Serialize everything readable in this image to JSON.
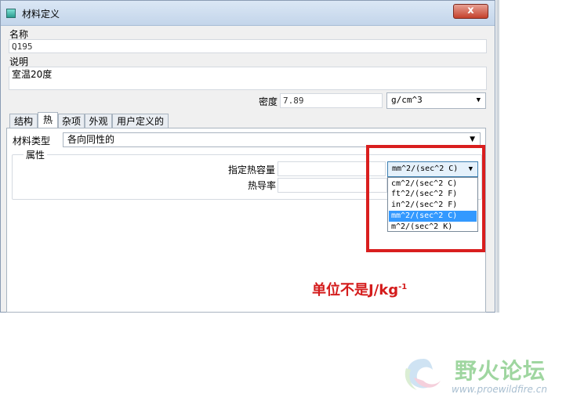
{
  "window": {
    "title": "材料定义",
    "close_label": "x"
  },
  "name": {
    "label": "名称",
    "value": "Q195"
  },
  "description": {
    "label": "说明",
    "value": "室温20度"
  },
  "density": {
    "label": "密度",
    "value": "7.89",
    "unit": "g/cm^3"
  },
  "tabs": [
    {
      "label": "结构",
      "active": false
    },
    {
      "label": "热",
      "active": true
    },
    {
      "label": "杂项",
      "active": false
    },
    {
      "label": "外观",
      "active": false
    },
    {
      "label": "用户定义的",
      "active": false
    }
  ],
  "material_type": {
    "label": "材料类型",
    "value": "各向同性的"
  },
  "properties": {
    "group_label": "属性",
    "specific_heat": {
      "label": "指定热容量",
      "value": "",
      "unit": "mm^2/(sec^2 C)"
    },
    "conductivity": {
      "label": "热导率",
      "value": ""
    }
  },
  "unit_options": [
    "cm^2/(sec^2 C)",
    "ft^2/(sec^2 F)",
    "in^2/(sec^2 F)",
    "mm^2/(sec^2 C)",
    "m^2/(sec^2 K)"
  ],
  "selected_option": "mm^2/(sec^2 C)",
  "annotation": {
    "text": "单位不是J/kg",
    "superscript": "-1",
    "color": "#d41c1c"
  },
  "watermark": {
    "brand": "野火论坛",
    "url": "www.proewildfire.cn"
  }
}
